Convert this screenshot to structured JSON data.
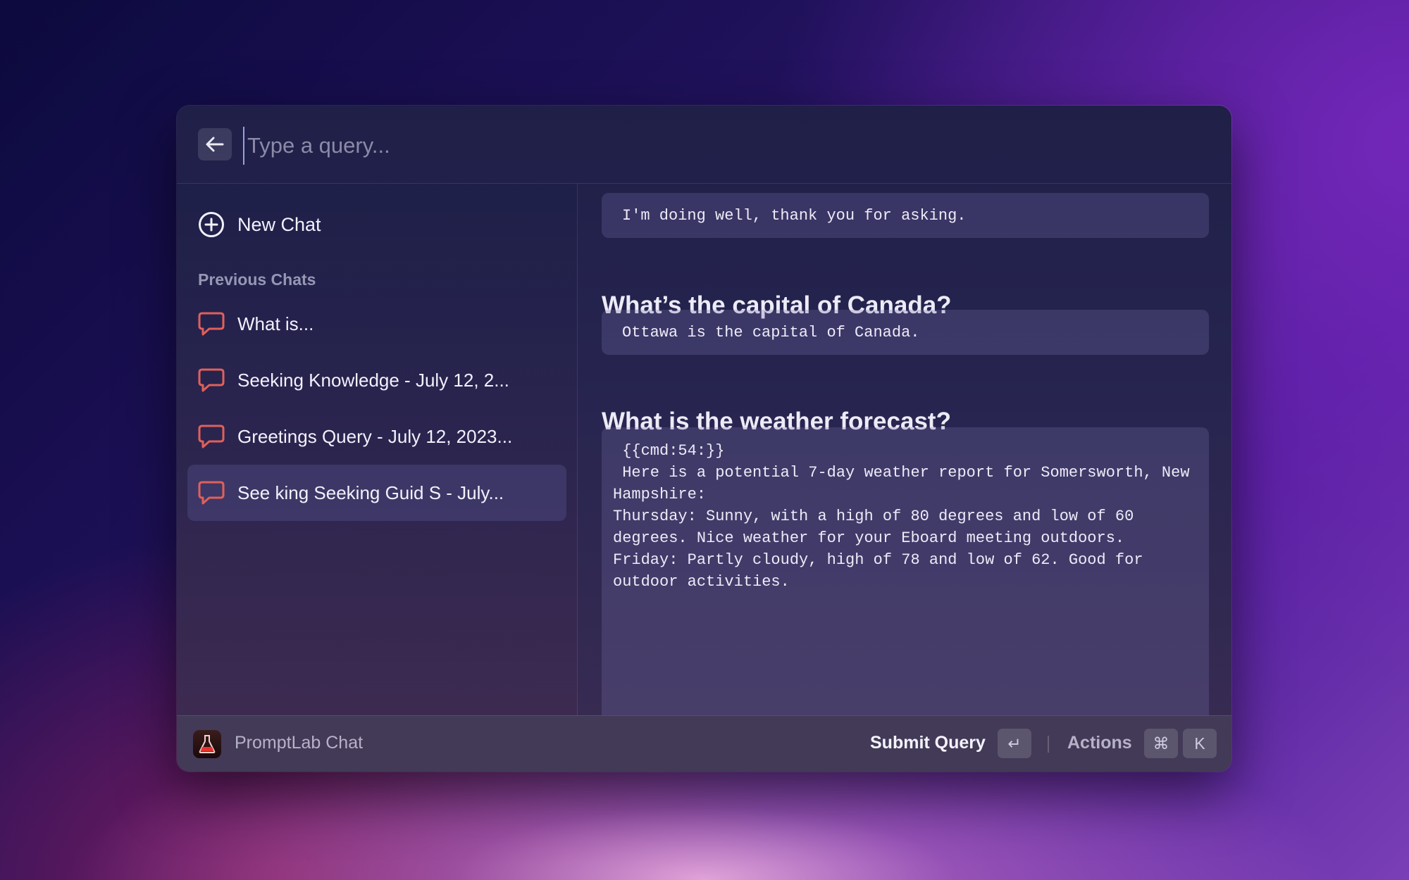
{
  "search": {
    "placeholder": "Type a query...",
    "value": ""
  },
  "sidebar": {
    "new_chat_label": "New Chat",
    "section_title": "Previous Chats",
    "items": [
      {
        "label": "What is...",
        "icon": "chat-bubble-icon"
      },
      {
        "label": "Seeking Knowledge - July 12, 2...",
        "icon": "chat-bubble-icon"
      },
      {
        "label": "Greetings Query - July 12, 2023...",
        "icon": "chat-bubble-icon"
      },
      {
        "label": "See king  Seeking Guid  S - July...",
        "icon": "chat-bubble-icon",
        "selected": true
      }
    ]
  },
  "conversation": {
    "messages": [
      {
        "response": "I'm doing well, thank you for asking."
      },
      {
        "question": "What’s the capital of Canada?",
        "response": "Ottawa is the capital of Canada."
      },
      {
        "question": "What is the weather forecast?",
        "response_lines": [
          " {{cmd:54:}}",
          "",
          "",
          "",
          " Here is a potential 7-day weather report for Somersworth, New",
          "Hampshire:",
          "",
          "Thursday: Sunny, with a high of 80 degrees and low of 60",
          "degrees. Nice weather for your Eboard meeting outdoors.",
          "",
          "Friday: Partly cloudy, high of 78 and low of 62. Good for",
          "outdoor activities."
        ]
      }
    ]
  },
  "footer": {
    "app_name": "PromptLab Chat",
    "primary_action": "Submit Query",
    "primary_key": "↵",
    "actions_label": "Actions",
    "actions_keys": [
      "⌘",
      "K"
    ]
  },
  "colors": {
    "chat_icon": "#e0605a",
    "accent_background_selected": "#3c3c6e",
    "app_icon_flask": "#e8342e"
  }
}
